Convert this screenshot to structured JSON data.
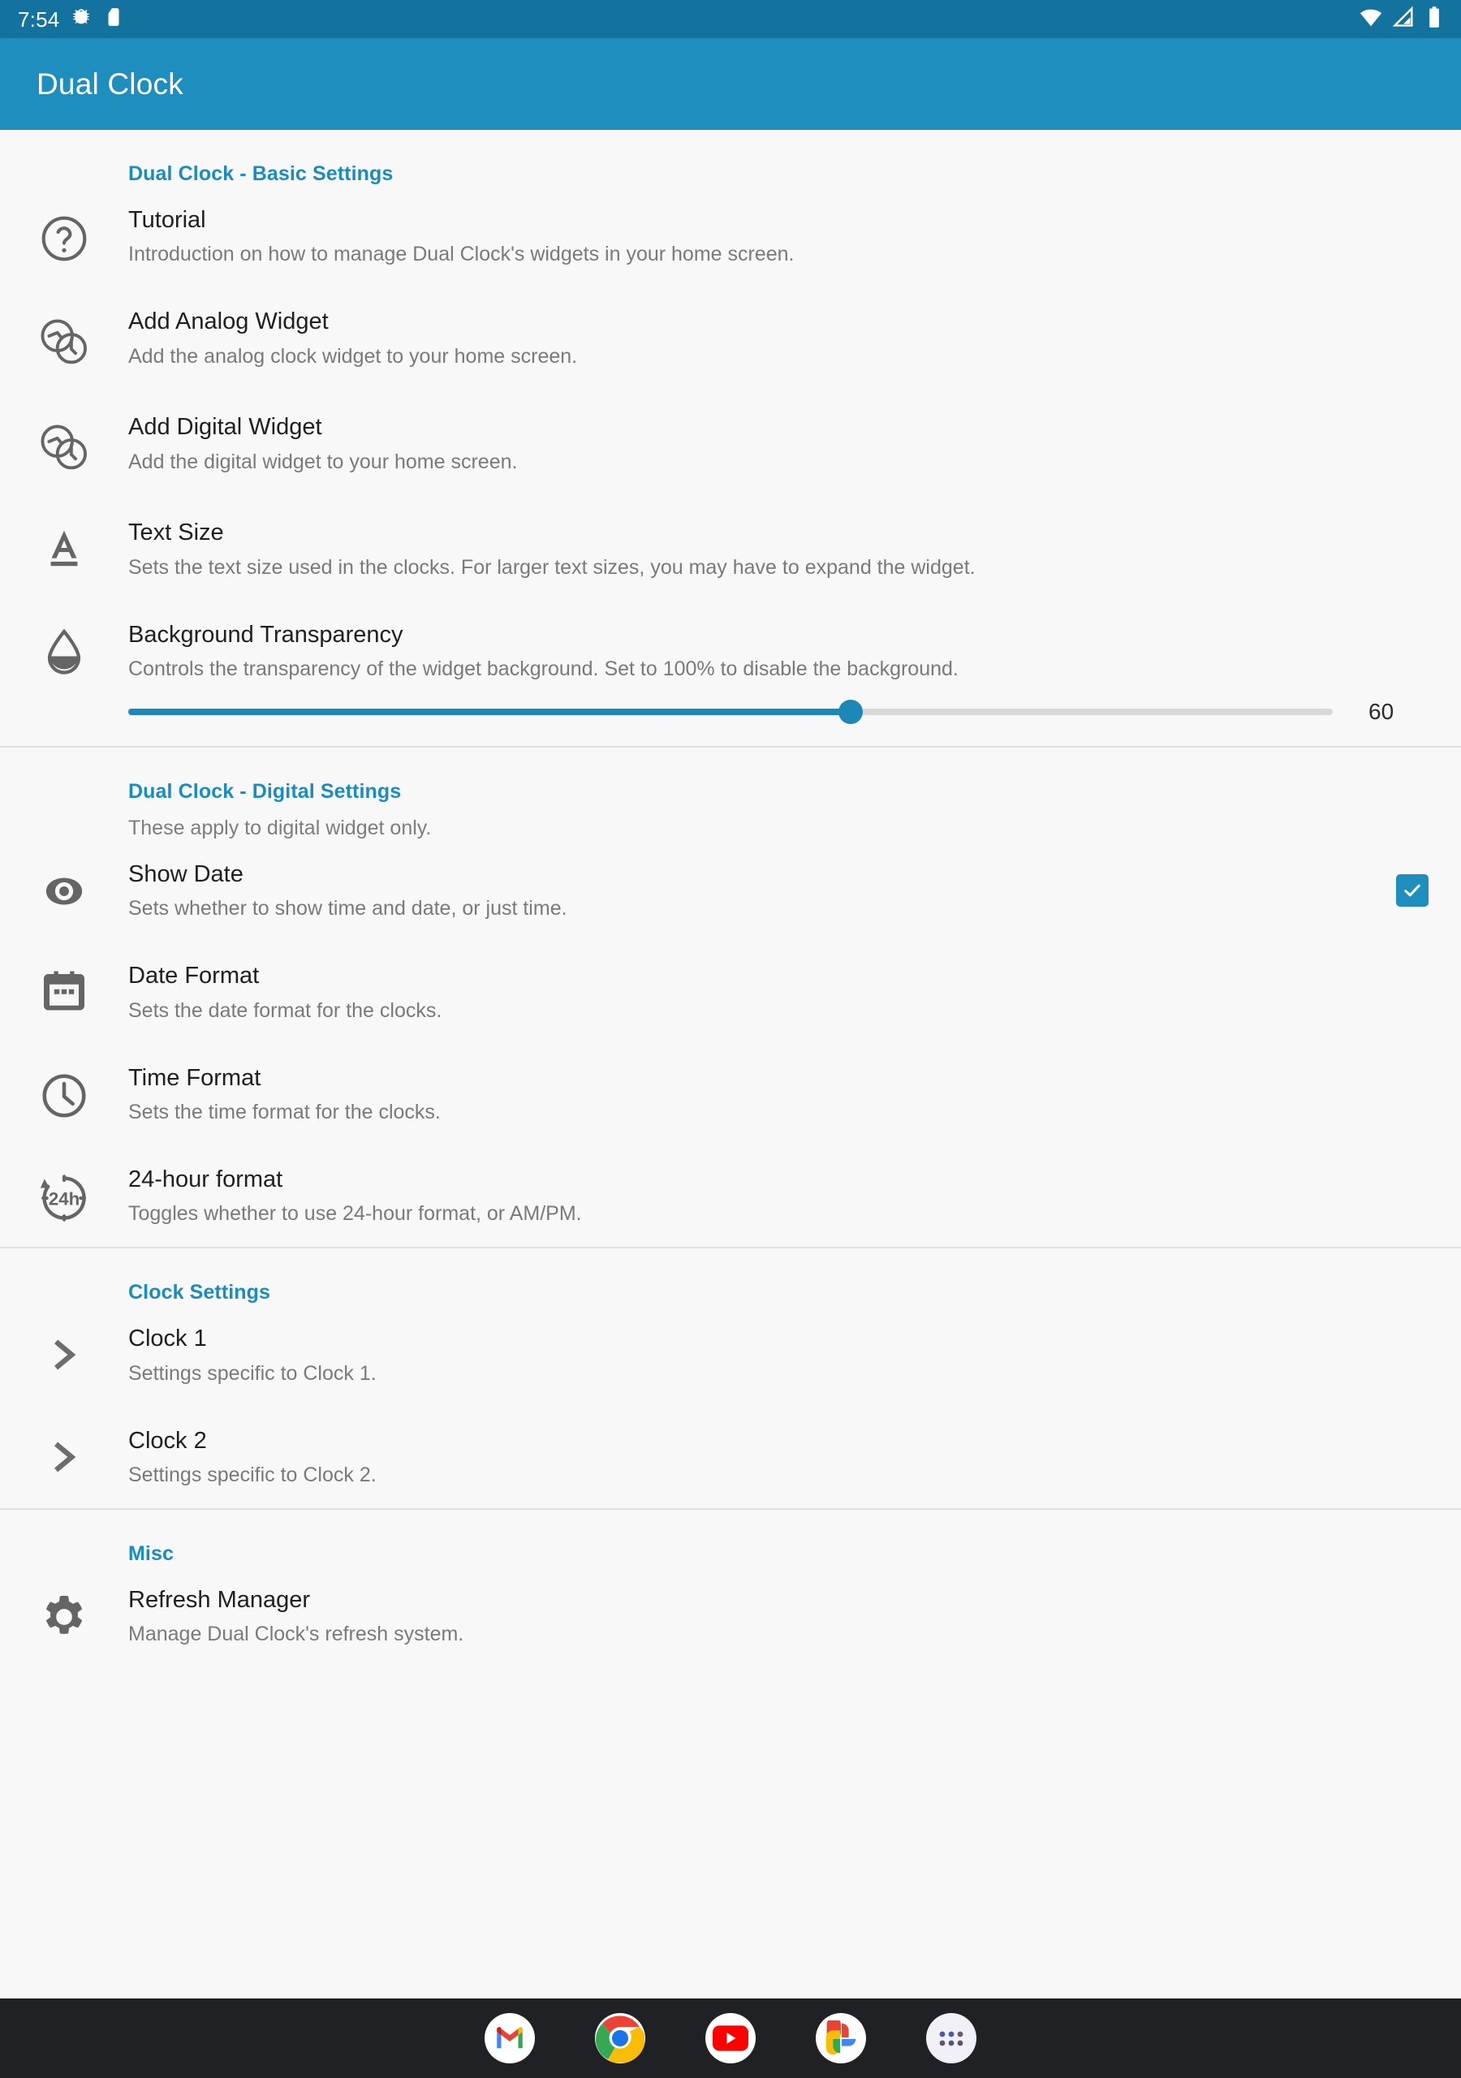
{
  "status_bar": {
    "time": "7:54",
    "left_icons": [
      "bug-icon",
      "sd-card-icon"
    ],
    "right_icons": [
      "wifi-icon",
      "cellular-signal-icon",
      "battery-icon"
    ],
    "background_color": "#14739e"
  },
  "app_bar": {
    "title": "Dual Clock",
    "background_color": "#1d8ebe",
    "text_color": "#ffffff"
  },
  "theme": {
    "accent": "#1d8ebe",
    "section_header_color": "#1a8cc0",
    "page_background": "#f8f8f8",
    "primary_text": "#1f1f1f",
    "secondary_text": "#7a7a7a",
    "icon_gray": "#656565",
    "divider": "#e0e0e0"
  },
  "sections": [
    {
      "id": "basic",
      "title": "Dual Clock - Basic Settings",
      "subtitle": "",
      "rows": [
        {
          "icon": "question-mark-circle-icon",
          "title": "Tutorial",
          "subtitle": "Introduction on how to manage Dual Clock's widgets in your home screen."
        },
        {
          "icon": "analog-clocks-icon",
          "title": "Add Analog Widget",
          "subtitle": "Add the analog clock widget to your home screen."
        },
        {
          "icon": "analog-clocks-icon",
          "title": "Add Digital Widget",
          "subtitle": "Add the digital widget to your home screen."
        },
        {
          "icon": "text-size-icon",
          "title": "Text Size",
          "subtitle": "Sets the text size used in the clocks. For larger text sizes, you may have to expand the widget."
        },
        {
          "icon": "water-drop-icon",
          "title": "Background Transparency",
          "subtitle": "Controls the transparency of the widget background. Set to 100% to disable the background.",
          "slider": {
            "value": "60",
            "min": 0,
            "max": 100,
            "percent": 60
          }
        }
      ]
    },
    {
      "id": "digital",
      "title": "Dual Clock - Digital Settings",
      "subtitle": "These apply to digital widget only.",
      "rows": [
        {
          "icon": "eye-icon",
          "title": "Show Date",
          "subtitle": "Sets whether to show time and date, or just time.",
          "checkbox": true
        },
        {
          "icon": "calendar-icon",
          "title": "Date Format",
          "subtitle": "Sets the date format for the clocks."
        },
        {
          "icon": "clock-icon",
          "title": "Time Format",
          "subtitle": "Sets the time format for the clocks."
        },
        {
          "icon": "24h-icon",
          "title": "24-hour format",
          "subtitle": "Toggles whether to use 24-hour format, or AM/PM."
        }
      ]
    },
    {
      "id": "clock",
      "title": "Clock Settings",
      "subtitle": "",
      "rows": [
        {
          "icon": "chevron-right-icon",
          "title": "Clock 1",
          "subtitle": "Settings specific to Clock 1."
        },
        {
          "icon": "chevron-right-icon",
          "title": "Clock 2",
          "subtitle": "Settings specific to Clock 2."
        }
      ]
    },
    {
      "id": "misc",
      "title": "Misc",
      "subtitle": "",
      "rows": [
        {
          "icon": "gear-icon",
          "title": "Refresh Manager",
          "subtitle": "Manage Dual Clock's refresh system."
        }
      ]
    }
  ],
  "dock": {
    "background_color": "#202124",
    "items": [
      {
        "name": "gmail-icon",
        "label": "Gmail"
      },
      {
        "name": "chrome-icon",
        "label": "Chrome"
      },
      {
        "name": "youtube-icon",
        "label": "YouTube"
      },
      {
        "name": "google-photos-icon",
        "label": "Photos"
      },
      {
        "name": "app-drawer-icon",
        "label": "All apps"
      }
    ]
  }
}
